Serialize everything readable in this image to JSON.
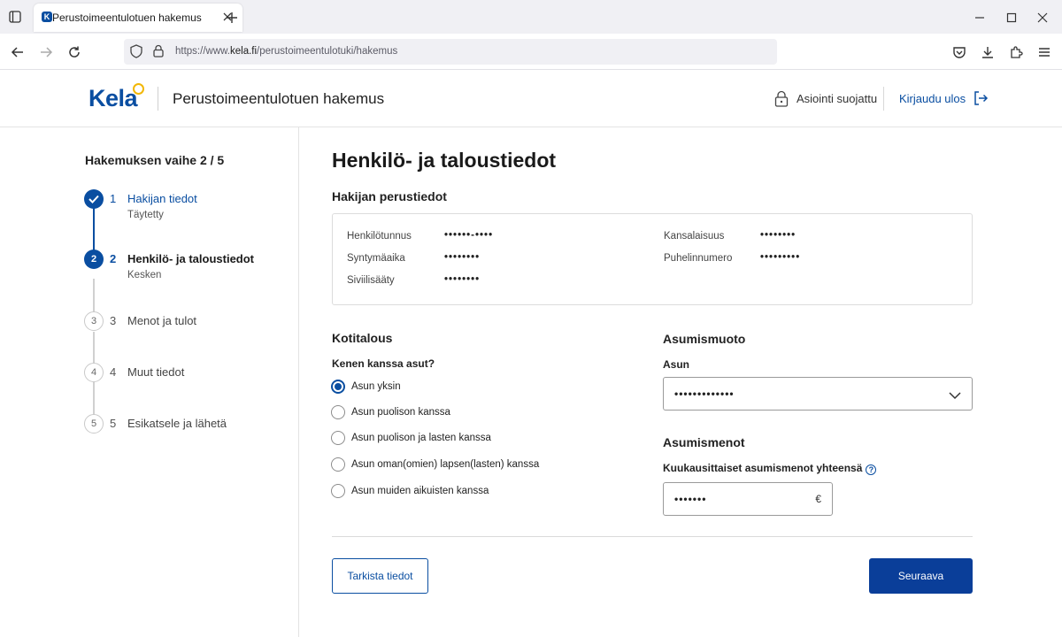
{
  "browser": {
    "tab_title": "Perustoimeentulotuen hakemus",
    "url_prefix": "https://www.",
    "url_domain": "kela.fi",
    "url_path": "/perustoimeentulotuki/hakemus"
  },
  "header": {
    "logo_text": "Kela",
    "title": "Perustoimeentulotuen hakemus",
    "secure_label": "Asiointi suojattu",
    "logout_label": "Kirjaudu ulos"
  },
  "stepper": {
    "heading": "Hakemuksen vaihe 2 / 5",
    "steps": [
      {
        "num": "1",
        "label": "Hakijan tiedot",
        "sub": "Täytetty",
        "state": "done"
      },
      {
        "num": "2",
        "label": "Henkilö- ja taloustiedot",
        "sub": "Kesken",
        "state": "active"
      },
      {
        "num": "3",
        "label": "Menot ja tulot",
        "sub": "",
        "state": "todo"
      },
      {
        "num": "4",
        "label": "Muut tiedot",
        "sub": "",
        "state": "todo"
      },
      {
        "num": "5",
        "label": "Esikatsele ja lähetä",
        "sub": "",
        "state": "todo"
      }
    ]
  },
  "main": {
    "title": "Henkilö- ja taloustiedot",
    "basic_info": {
      "heading": "Hakijan perustiedot",
      "fields": [
        {
          "label": "Henkilötunnus",
          "value": "••••••-••••"
        },
        {
          "label": "Syntymäaika",
          "value": "••••••••"
        },
        {
          "label": "Siviilisääty",
          "value": "••••••••"
        },
        {
          "label": "Kansalaisuus",
          "value": "••••••••"
        },
        {
          "label": "Puhelinnumero",
          "value": "•••••••••"
        }
      ]
    },
    "household": {
      "heading": "Kotitalous",
      "question": "Kenen kanssa asut?",
      "options": [
        {
          "label": "Asun yksin",
          "checked": true
        },
        {
          "label": "Asun puolison kanssa",
          "checked": false
        },
        {
          "label": "Asun puolison ja lasten kanssa",
          "checked": false
        },
        {
          "label": "Asun oman(omien) lapsen(lasten) kanssa",
          "checked": false
        },
        {
          "label": "Asun muiden aikuisten kanssa",
          "checked": false
        }
      ]
    },
    "housing": {
      "heading": "Asumismuoto",
      "label": "Asun",
      "value": "•••••••••••••"
    },
    "housing_costs": {
      "heading": "Asumismenot",
      "label": "Kuukausittaiset asumismenot yhteensä",
      "value": "•••••••",
      "currency": "€"
    },
    "actions": {
      "check_label": "Tarkista tiedot",
      "next_label": "Seuraava"
    }
  },
  "colors": {
    "brand": "#0a4ea1",
    "primary_button": "#0a3e99",
    "logo_accent": "#f2b705"
  }
}
